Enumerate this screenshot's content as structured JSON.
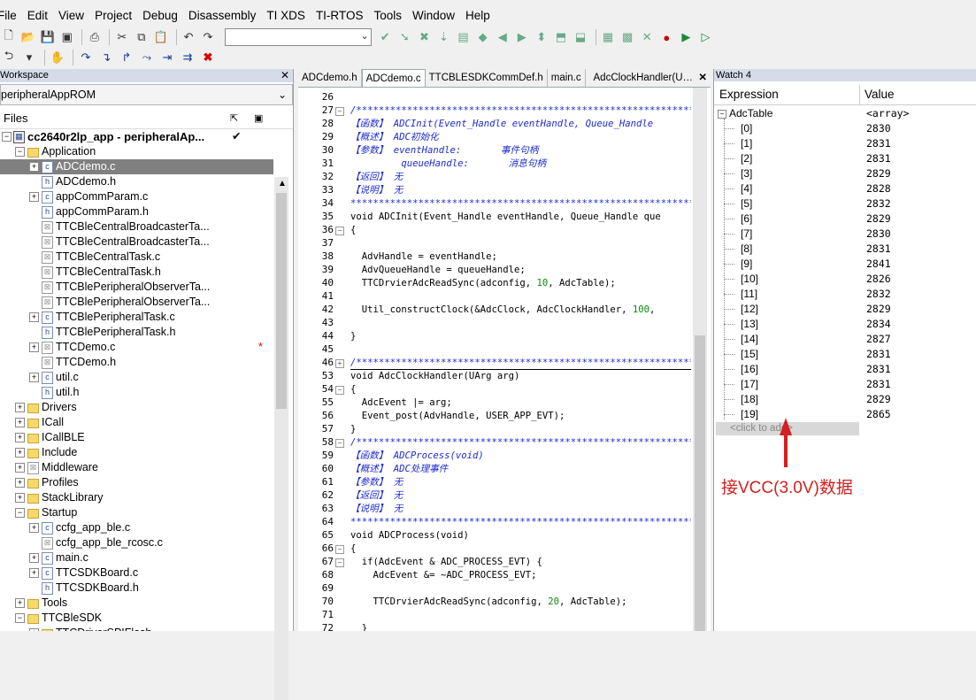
{
  "menu": [
    "File",
    "Edit",
    "View",
    "Project",
    "Debug",
    "Disassembly",
    "TI XDS",
    "TI-RTOS",
    "Tools",
    "Window",
    "Help"
  ],
  "workspace": {
    "title": "Workspace",
    "config": "peripheralAppROM",
    "files_label": "Files",
    "project": "cc2640r2lp_app - peripheralAp...",
    "tree": [
      {
        "label": "Application",
        "type": "folder",
        "level": 1,
        "exp": "-"
      },
      {
        "label": "ADCdemo.c",
        "type": "c",
        "level": 2,
        "exp": "+",
        "sel": true
      },
      {
        "label": "ADCdemo.h",
        "type": "h",
        "level": 2
      },
      {
        "label": "appCommParam.c",
        "type": "c",
        "level": 2,
        "exp": "+"
      },
      {
        "label": "appCommParam.h",
        "type": "h",
        "level": 2
      },
      {
        "label": "TTCBleCentralBroadcasterTa...",
        "type": "x",
        "level": 2
      },
      {
        "label": "TTCBleCentralBroadcasterTa...",
        "type": "x",
        "level": 2
      },
      {
        "label": "TTCBleCentralTask.c",
        "type": "x",
        "level": 2
      },
      {
        "label": "TTCBleCentralTask.h",
        "type": "x",
        "level": 2
      },
      {
        "label": "TTCBlePeripheralObserverTa...",
        "type": "x",
        "level": 2
      },
      {
        "label": "TTCBlePeripheralObserverTa...",
        "type": "x",
        "level": 2
      },
      {
        "label": "TTCBlePeripheralTask.c",
        "type": "c",
        "level": 2,
        "exp": "+"
      },
      {
        "label": "TTCBlePeripheralTask.h",
        "type": "h",
        "level": 2
      },
      {
        "label": "TTCDemo.c",
        "type": "x",
        "level": 2,
        "exp": "+",
        "star": "*"
      },
      {
        "label": "TTCDemo.h",
        "type": "x",
        "level": 2
      },
      {
        "label": "util.c",
        "type": "c",
        "level": 2,
        "exp": "+"
      },
      {
        "label": "util.h",
        "type": "h",
        "level": 2
      },
      {
        "label": "Drivers",
        "type": "folder",
        "level": 1,
        "exp": "+"
      },
      {
        "label": "ICall",
        "type": "folder",
        "level": 1,
        "exp": "+"
      },
      {
        "label": "ICallBLE",
        "type": "folder",
        "level": 1,
        "exp": "+"
      },
      {
        "label": "Include",
        "type": "folder",
        "level": 1,
        "exp": "+"
      },
      {
        "label": "Middleware",
        "type": "xfolder",
        "level": 1,
        "exp": "+"
      },
      {
        "label": "Profiles",
        "type": "folder",
        "level": 1,
        "exp": "+"
      },
      {
        "label": "StackLibrary",
        "type": "folder",
        "level": 1,
        "exp": "+"
      },
      {
        "label": "Startup",
        "type": "folder",
        "level": 1,
        "exp": "-"
      },
      {
        "label": "ccfg_app_ble.c",
        "type": "c",
        "level": 2,
        "exp": "+"
      },
      {
        "label": "ccfg_app_ble_rcosc.c",
        "type": "x",
        "level": 2
      },
      {
        "label": "main.c",
        "type": "c",
        "level": 2,
        "exp": "+"
      },
      {
        "label": "TTCSDKBoard.c",
        "type": "c",
        "level": 2,
        "exp": "+"
      },
      {
        "label": "TTCSDKBoard.h",
        "type": "h",
        "level": 2
      },
      {
        "label": "Tools",
        "type": "folder",
        "level": 1,
        "exp": "+"
      },
      {
        "label": "TTCBleSDK",
        "type": "folder",
        "level": 1,
        "exp": "-"
      },
      {
        "label": "TTCDriverSPIFlash",
        "type": "folder",
        "level": 2,
        "exp": "+"
      }
    ]
  },
  "editor": {
    "tabs": [
      "ADCdemo.h",
      "ADCdemo.c",
      "TTCBLESDKCommDef.h",
      "main.c"
    ],
    "active_tab": 1,
    "function_label": "AdcClockHandler(U…",
    "lines": [
      {
        "n": "26",
        "t": "",
        "f": ""
      },
      {
        "n": "27",
        "t": "/**************************************************************",
        "cls": "cmt",
        "f": "-"
      },
      {
        "n": "28",
        "t": "【函数】 ADCInit(Event_Handle eventHandle, Queue_Handle",
        "cls": "cmt"
      },
      {
        "n": "29",
        "t": "【概述】 ADC初始化",
        "cls": "cmt"
      },
      {
        "n": "30",
        "t": "【参数】 eventHandle:       事件句柄",
        "cls": "cmt"
      },
      {
        "n": "31",
        "t": "         queueHandle:       消息句柄",
        "cls": "cmt"
      },
      {
        "n": "32",
        "t": "【返回】 无",
        "cls": "cmt"
      },
      {
        "n": "33",
        "t": "【说明】 无",
        "cls": "cmt"
      },
      {
        "n": "34",
        "t": "**************************************************************",
        "cls": "cmt"
      },
      {
        "n": "35",
        "t": "void ADCInit(Event_Handle eventHandle, Queue_Handle que"
      },
      {
        "n": "36",
        "t": "{",
        "f": "-"
      },
      {
        "n": "37",
        "t": ""
      },
      {
        "n": "38",
        "t": "  AdvHandle = eventHandle;"
      },
      {
        "n": "39",
        "t": "  AdvQueueHandle = queueHandle;"
      },
      {
        "n": "40",
        "t": "  TTCDrvierAdcReadSync(adconfig, ",
        "num": "10",
        "t2": ", AdcTable);"
      },
      {
        "n": "41",
        "t": ""
      },
      {
        "n": "42",
        "t": "  Util_constructClock(&AdcClock, AdcClockHandler, ",
        "num": "100",
        "t2": ","
      },
      {
        "n": "43",
        "t": ""
      },
      {
        "n": "44",
        "t": "}"
      },
      {
        "n": "45",
        "t": ""
      },
      {
        "n": "46",
        "t": "/**************************************************************",
        "cls": "cmt",
        "f": "+"
      },
      {
        "n": "53",
        "t": "void AdcClockHandler(UArg arg)",
        "dash": true
      },
      {
        "n": "54",
        "t": "{",
        "f": "-"
      },
      {
        "n": "55",
        "t": "  AdcEvent |= arg;"
      },
      {
        "n": "56",
        "t": "  Event_post(AdvHandle, USER_APP_EVT);"
      },
      {
        "n": "57",
        "t": "}"
      },
      {
        "n": "58",
        "t": "/**************************************************************",
        "cls": "cmt",
        "f": "-"
      },
      {
        "n": "59",
        "t": "【函数】 ADCProcess(void)",
        "cls": "cmt"
      },
      {
        "n": "60",
        "t": "【概述】 ADC处理事件",
        "cls": "cmt"
      },
      {
        "n": "61",
        "t": "【参数】 无",
        "cls": "cmt"
      },
      {
        "n": "62",
        "t": "【返回】 无",
        "cls": "cmt"
      },
      {
        "n": "63",
        "t": "【说明】 无",
        "cls": "cmt"
      },
      {
        "n": "64",
        "t": "**************************************************************",
        "cls": "cmt"
      },
      {
        "n": "65",
        "t": "void ADCProcess(void)"
      },
      {
        "n": "66",
        "t": "{",
        "f": "-"
      },
      {
        "n": "67",
        "t": "  if(AdcEvent & ADC_PROCESS_EVT) {",
        "f": "-"
      },
      {
        "n": "68",
        "t": "    AdcEvent &= ~ADC_PROCESS_EVT;"
      },
      {
        "n": "69",
        "t": ""
      },
      {
        "n": "70",
        "t": "    TTCDrvierAdcReadSync(adconfig, ",
        "num": "20",
        "t2": ", AdcTable);"
      },
      {
        "n": "71",
        "t": ""
      },
      {
        "n": "72",
        "t": "  }"
      }
    ]
  },
  "watch": {
    "title": "Watch 4",
    "col_expression": "Expression",
    "col_value": "Value",
    "root": {
      "name": "AdcTable",
      "value": "<array>"
    },
    "items": [
      {
        "idx": "[0]",
        "v": "2830"
      },
      {
        "idx": "[1]",
        "v": "2831"
      },
      {
        "idx": "[2]",
        "v": "2831"
      },
      {
        "idx": "[3]",
        "v": "2829"
      },
      {
        "idx": "[4]",
        "v": "2828"
      },
      {
        "idx": "[5]",
        "v": "2832"
      },
      {
        "idx": "[6]",
        "v": "2829"
      },
      {
        "idx": "[7]",
        "v": "2830"
      },
      {
        "idx": "[8]",
        "v": "2831"
      },
      {
        "idx": "[9]",
        "v": "2841"
      },
      {
        "idx": "[10]",
        "v": "2826"
      },
      {
        "idx": "[11]",
        "v": "2832"
      },
      {
        "idx": "[12]",
        "v": "2829"
      },
      {
        "idx": "[13]",
        "v": "2834"
      },
      {
        "idx": "[14]",
        "v": "2827"
      },
      {
        "idx": "[15]",
        "v": "2831"
      },
      {
        "idx": "[16]",
        "v": "2831"
      },
      {
        "idx": "[17]",
        "v": "2831"
      },
      {
        "idx": "[18]",
        "v": "2829"
      },
      {
        "idx": "[19]",
        "v": "2865"
      }
    ],
    "add_placeholder": "<click to add>"
  },
  "annotation": "接VCC(3.0V)数据",
  "colors": {
    "annotation": "#d42020",
    "comment": "#1c2bd4",
    "number": "#0a8a0a",
    "selection": "#808080"
  }
}
